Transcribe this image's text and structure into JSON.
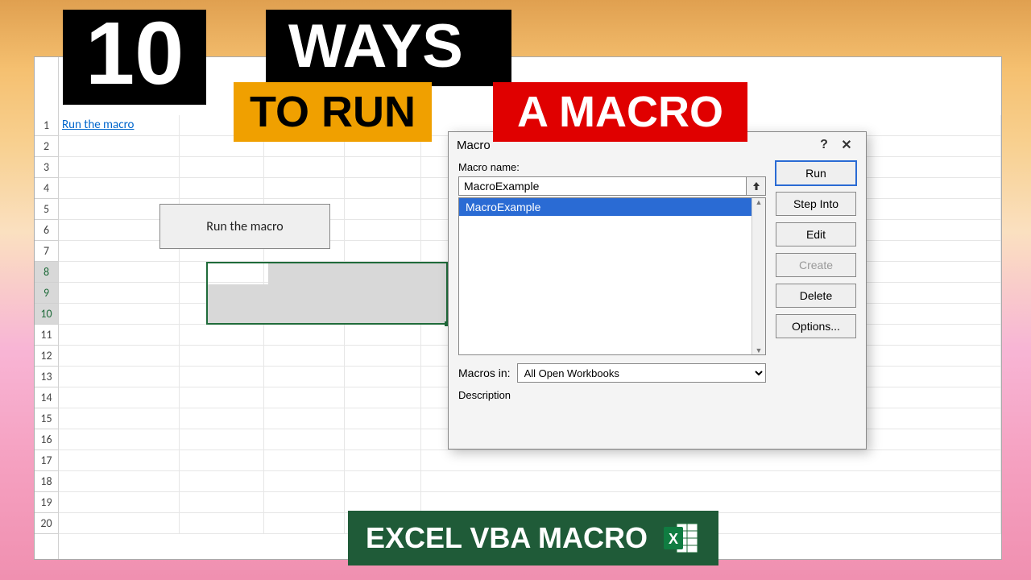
{
  "overlay": {
    "ten": "10",
    "ways": "WAYS",
    "to_run": "TO RUN",
    "a_macro": "A MACRO",
    "bottom": "EXCEL VBA MACRO",
    "excel_letter": "X"
  },
  "sheet": {
    "row_numbers": [
      "1",
      "2",
      "3",
      "4",
      "5",
      "6",
      "7",
      "8",
      "9",
      "10",
      "11",
      "12",
      "13",
      "14",
      "15",
      "16",
      "17",
      "18",
      "19",
      "20"
    ],
    "cell_a1": "Run the macro",
    "button_label": "Run the macro"
  },
  "dialog": {
    "title": "Macro",
    "help": "?",
    "close": "✕",
    "macro_name_label": "Macro name:",
    "macro_name_value": "MacroExample",
    "list_item": "MacroExample",
    "macros_in_label": "Macros in:",
    "macros_in_value": "All Open Workbooks",
    "desc_label": "Description",
    "buttons": {
      "run": "Run",
      "step": "Step Into",
      "edit": "Edit",
      "create": "Create",
      "delete": "Delete",
      "options": "Options..."
    }
  }
}
